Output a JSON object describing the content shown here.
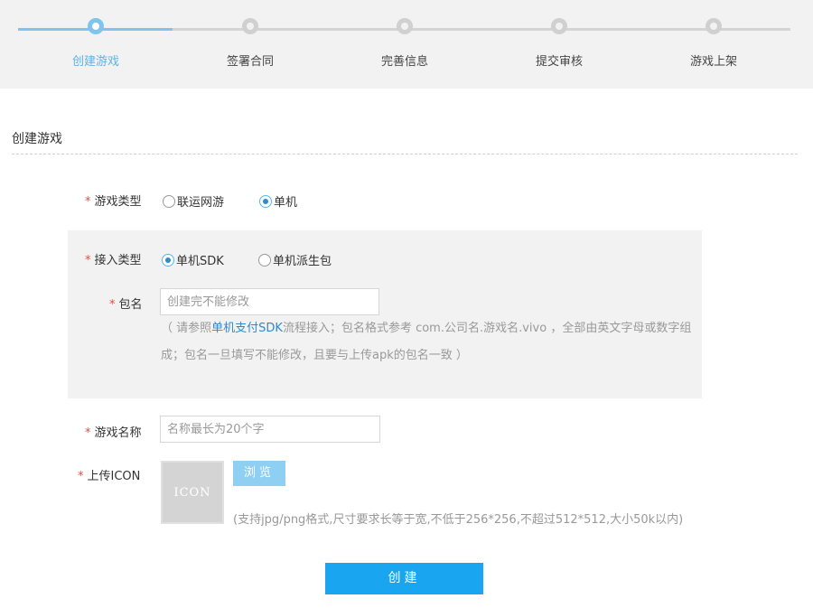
{
  "stepper": {
    "steps": [
      {
        "label": "创建游戏",
        "active": true
      },
      {
        "label": "签署合同",
        "active": false
      },
      {
        "label": "完善信息",
        "active": false
      },
      {
        "label": "提交审核",
        "active": false
      },
      {
        "label": "游戏上架",
        "active": false
      }
    ]
  },
  "section": {
    "title": "创建游戏"
  },
  "form": {
    "required_mark": "*",
    "game_type": {
      "label": "游戏类型",
      "options": [
        {
          "label": "联运网游",
          "checked": false
        },
        {
          "label": "单机",
          "checked": true
        }
      ]
    },
    "access_type": {
      "label": "接入类型",
      "options": [
        {
          "label": "单机SDK",
          "checked": true
        },
        {
          "label": "单机派生包",
          "checked": false
        }
      ]
    },
    "package_name": {
      "label": "包名",
      "placeholder": "创建完不能修改",
      "value": "",
      "hint_prefix": "（ 请参照",
      "hint_link": "单机支付SDK",
      "hint_suffix": "流程接入；包名格式参考 com.公司名.游戏名.vivo ，全部由英文字母或数字组成；包名一旦填写不能修改，且要与上传apk的包名一致 ）"
    },
    "game_name": {
      "label": "游戏名称",
      "placeholder": "名称最长为20个字",
      "value": ""
    },
    "upload_icon": {
      "label": "上传ICON",
      "preview_text": "ICON",
      "browse_label": "浏览",
      "hint": "(支持jpg/png格式,尺寸要求长等于宽,不低于256*256,不超过512*512,大小50k以内)"
    },
    "submit_label": "创建"
  },
  "colors": {
    "accent": "#1aa5f0",
    "step_active": "#7ec4ec",
    "step_inactive": "#d0d0d0",
    "required": "#e74c3c",
    "link": "#2d8bd0"
  }
}
